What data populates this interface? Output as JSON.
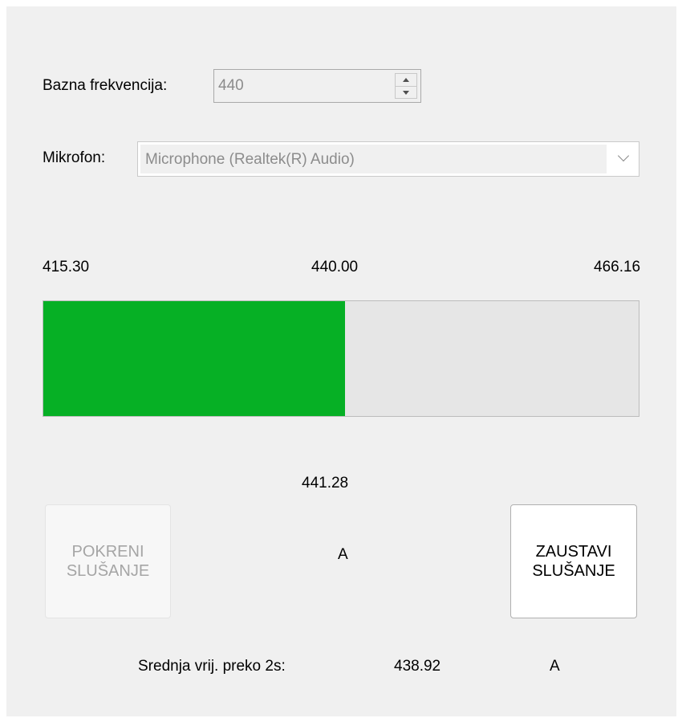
{
  "base_frequency": {
    "label": "Bazna frekvencija:",
    "value": "440"
  },
  "microphone": {
    "label": "Mikrofon:",
    "selected": "Microphone (Realtek(R) Audio)"
  },
  "scale": {
    "min_label": "415.30",
    "center_label": "440.00",
    "max_label": "466.16"
  },
  "tuning_bar": {
    "fill_fraction": 0.507,
    "fill_color": "#06b025"
  },
  "current": {
    "frequency": "441.28",
    "note": "A"
  },
  "buttons": {
    "start_label": "POKRENI\nSLUŠANJE",
    "stop_label": "ZAUSTAVI\nSLUŠANJE"
  },
  "average": {
    "label": "Srednja vrij. preko 2s:",
    "frequency": "438.92",
    "note": "A"
  }
}
